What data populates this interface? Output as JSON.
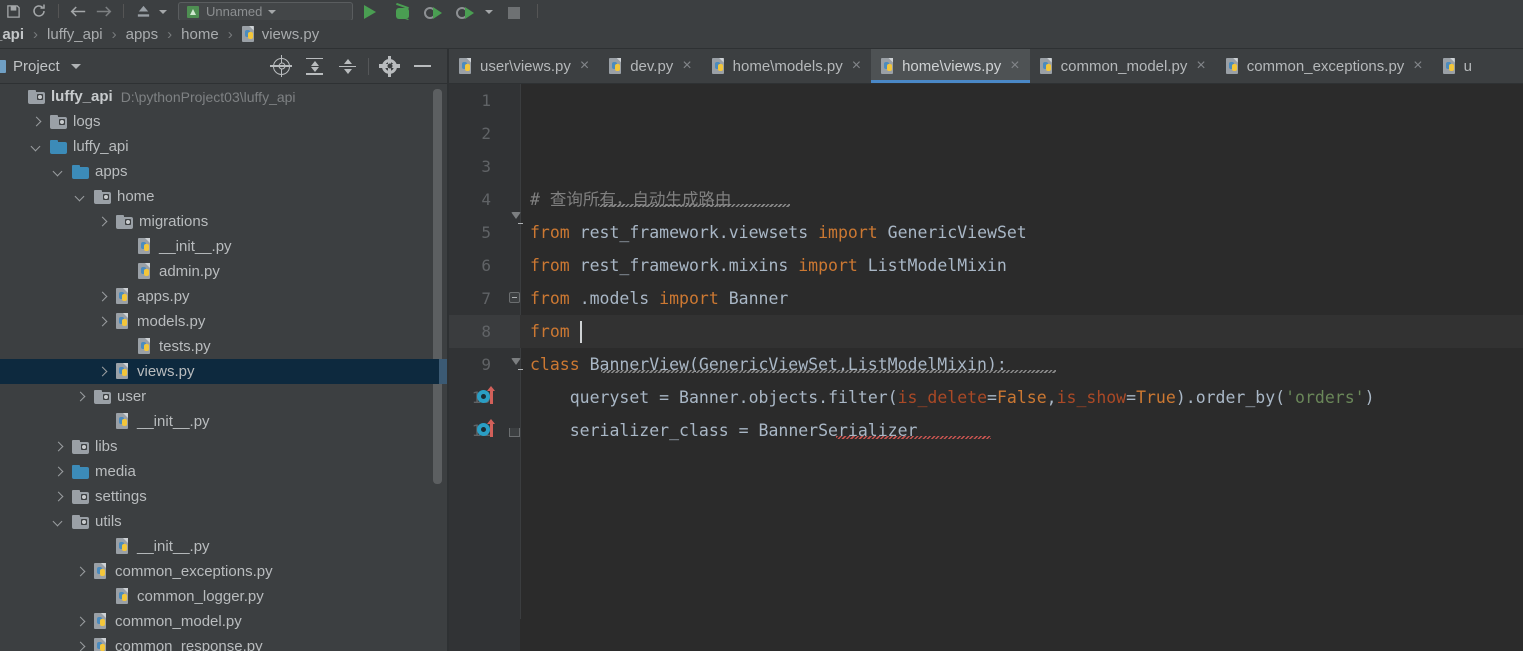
{
  "toolbar": {
    "run_config_label": "Unnamed",
    "icons": [
      "save-icon",
      "sync-icon",
      "back-arrow-icon",
      "forward-arrow-icon",
      "vcs-update-icon"
    ],
    "run_label": "Run",
    "debug_label": "Debug",
    "coverage_label": "Run with Coverage",
    "profile_label": "Profile",
    "stop_label": "Stop"
  },
  "breadcrumb": {
    "items": [
      "_api",
      "luffy_api",
      "apps",
      "home"
    ],
    "file": "views.py",
    "separator": "›"
  },
  "project_panel": {
    "title": "Project",
    "actions": [
      "select-opened-file-icon",
      "expand-all-icon",
      "collapse-all-icon",
      "settings-icon",
      "hide-icon"
    ],
    "tree": [
      {
        "label": "luffy_api",
        "path": "D:\\pythonProject03\\luffy_api",
        "indent": 0,
        "arrow": "none",
        "icon": "folder-gray",
        "bold": true,
        "selected": false
      },
      {
        "label": "logs",
        "path": "",
        "indent": 1,
        "arrow": "right",
        "icon": "folder-gray",
        "bold": false,
        "selected": false
      },
      {
        "label": "luffy_api",
        "path": "",
        "indent": 1,
        "arrow": "down",
        "icon": "folder-blue",
        "bold": false,
        "selected": false
      },
      {
        "label": "apps",
        "path": "",
        "indent": 2,
        "arrow": "down",
        "icon": "folder-blue",
        "bold": false,
        "selected": false
      },
      {
        "label": "home",
        "path": "",
        "indent": 3,
        "arrow": "down",
        "icon": "folder-gray",
        "bold": false,
        "selected": false
      },
      {
        "label": "migrations",
        "path": "",
        "indent": 4,
        "arrow": "right",
        "icon": "folder-gray",
        "bold": false,
        "selected": false
      },
      {
        "label": "__init__.py",
        "path": "",
        "indent": 5,
        "arrow": "none",
        "icon": "python-file",
        "bold": false,
        "selected": false
      },
      {
        "label": "admin.py",
        "path": "",
        "indent": 5,
        "arrow": "none",
        "icon": "python-file",
        "bold": false,
        "selected": false
      },
      {
        "label": "apps.py",
        "path": "",
        "indent": 4,
        "arrow": "right",
        "icon": "python-file",
        "bold": false,
        "selected": false
      },
      {
        "label": "models.py",
        "path": "",
        "indent": 4,
        "arrow": "right",
        "icon": "python-file",
        "bold": false,
        "selected": false
      },
      {
        "label": "tests.py",
        "path": "",
        "indent": 5,
        "arrow": "none",
        "icon": "python-file",
        "bold": false,
        "selected": false
      },
      {
        "label": "views.py",
        "path": "",
        "indent": 4,
        "arrow": "right",
        "icon": "python-file",
        "bold": false,
        "selected": true
      },
      {
        "label": "user",
        "path": "",
        "indent": 3,
        "arrow": "right",
        "icon": "folder-gray",
        "bold": false,
        "selected": false
      },
      {
        "label": "__init__.py",
        "path": "",
        "indent": 4,
        "arrow": "none",
        "icon": "python-file",
        "bold": false,
        "selected": false
      },
      {
        "label": "libs",
        "path": "",
        "indent": 2,
        "arrow": "right",
        "icon": "folder-gray",
        "bold": false,
        "selected": false
      },
      {
        "label": "media",
        "path": "",
        "indent": 2,
        "arrow": "right",
        "icon": "folder-blue",
        "bold": false,
        "selected": false
      },
      {
        "label": "settings",
        "path": "",
        "indent": 2,
        "arrow": "right",
        "icon": "folder-gray",
        "bold": false,
        "selected": false
      },
      {
        "label": "utils",
        "path": "",
        "indent": 2,
        "arrow": "down",
        "icon": "folder-gray",
        "bold": false,
        "selected": false
      },
      {
        "label": "__init__.py",
        "path": "",
        "indent": 4,
        "arrow": "none",
        "icon": "python-file",
        "bold": false,
        "selected": false
      },
      {
        "label": "common_exceptions.py",
        "path": "",
        "indent": 3,
        "arrow": "right",
        "icon": "python-file",
        "bold": false,
        "selected": false
      },
      {
        "label": "common_logger.py",
        "path": "",
        "indent": 4,
        "arrow": "none",
        "icon": "python-file",
        "bold": false,
        "selected": false
      },
      {
        "label": "common_model.py",
        "path": "",
        "indent": 3,
        "arrow": "right",
        "icon": "python-file",
        "bold": false,
        "selected": false
      },
      {
        "label": "common_response.py",
        "path": "",
        "indent": 3,
        "arrow": "right",
        "icon": "python-file",
        "bold": false,
        "selected": false
      }
    ]
  },
  "editor_tabs": {
    "close_glyph": "×",
    "tabs": [
      {
        "label": "user\\views.py",
        "active": false,
        "closable": true
      },
      {
        "label": "dev.py",
        "active": false,
        "closable": true
      },
      {
        "label": "home\\models.py",
        "active": false,
        "closable": true
      },
      {
        "label": "home\\views.py",
        "active": true,
        "closable": true
      },
      {
        "label": "common_model.py",
        "active": false,
        "closable": true
      },
      {
        "label": "common_exceptions.py",
        "active": false,
        "closable": true
      },
      {
        "label": "u",
        "active": false,
        "closable": false
      }
    ]
  },
  "editor": {
    "current_line": 8,
    "lines": [
      {
        "num": 1,
        "text": ""
      },
      {
        "num": 2,
        "text": ""
      },
      {
        "num": 3,
        "text": ""
      },
      {
        "num": 4,
        "text": "# 查询所有，自动生成路由"
      },
      {
        "num": 5,
        "text": "from rest_framework.viewsets import GenericViewSet"
      },
      {
        "num": 6,
        "text": "from rest_framework.mixins import ListModelMixin"
      },
      {
        "num": 7,
        "text": "from .models import Banner"
      },
      {
        "num": 8,
        "text": "from "
      },
      {
        "num": 9,
        "text": "class BannerView(GenericViewSet,ListModelMixin):"
      },
      {
        "num": 10,
        "text": "    queryset = Banner.objects.filter(is_delete=False,is_show=True).order_by('orders')"
      },
      {
        "num": 11,
        "text": "    serializer_class = BannerSerializer"
      }
    ]
  },
  "colors": {
    "keyword": "#cc7832",
    "identifier": "#a9b7c6",
    "string": "#6a8759",
    "comment": "#808080",
    "named_arg": "#aa4926",
    "editor_bg": "#2b2b2b",
    "gutter_bg": "#313335",
    "panel_bg": "#3c3f41",
    "selection_bg": "#0d293e",
    "active_tab_underline": "#4a88c7"
  }
}
